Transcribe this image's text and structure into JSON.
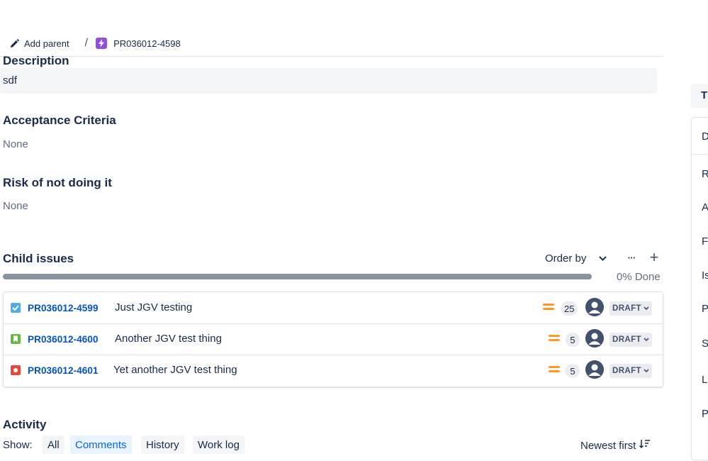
{
  "breadcrumb": {
    "add_parent_label": "Add parent",
    "separator": "/",
    "issue_key": "PR036012-4598"
  },
  "description": {
    "heading": "Description",
    "value": "sdf"
  },
  "acceptance": {
    "heading": "Acceptance Criteria",
    "value": "None"
  },
  "risk": {
    "heading": "Risk of not doing it",
    "value": "None"
  },
  "child_issues": {
    "heading": "Child issues",
    "order_by_label": "Order by",
    "more_label": "···",
    "add_label": "+",
    "progress_percent": 0,
    "progress_label": "0% Done",
    "items": [
      {
        "type": "task",
        "type_color": "#4bade8",
        "key": "PR036012-4599",
        "summary": "Just JGV testing",
        "priority": "medium",
        "points": "25",
        "status": "DRAFT"
      },
      {
        "type": "story",
        "type_color": "#63ba3c",
        "key": "PR036012-4600",
        "summary": "Another JGV test thing",
        "priority": "medium",
        "points": "5",
        "status": "DRAFT"
      },
      {
        "type": "bug",
        "type_color": "#e5493a",
        "key": "PR036012-4601",
        "summary": "Yet another JGV test thing",
        "priority": "medium",
        "points": "5",
        "status": "DRAFT"
      }
    ]
  },
  "activity": {
    "heading": "Activity",
    "show_label": "Show:",
    "tabs": [
      {
        "label": "All",
        "active": false
      },
      {
        "label": "Comments",
        "active": true
      },
      {
        "label": "History",
        "active": false
      },
      {
        "label": "Work log",
        "active": false
      }
    ],
    "sort_label": "Newest first"
  },
  "right_panel": {
    "top_letter": "T",
    "items": [
      "D",
      "R",
      "A",
      "F",
      "Is",
      "P",
      "S",
      "L",
      "P"
    ]
  },
  "colors": {
    "link": "#0052cc",
    "accent_tab_bg": "#e9f2ff",
    "accent_tab_text": "#0c66e4",
    "priority_medium": "#ff991f",
    "story_purple": "#904ee2"
  }
}
